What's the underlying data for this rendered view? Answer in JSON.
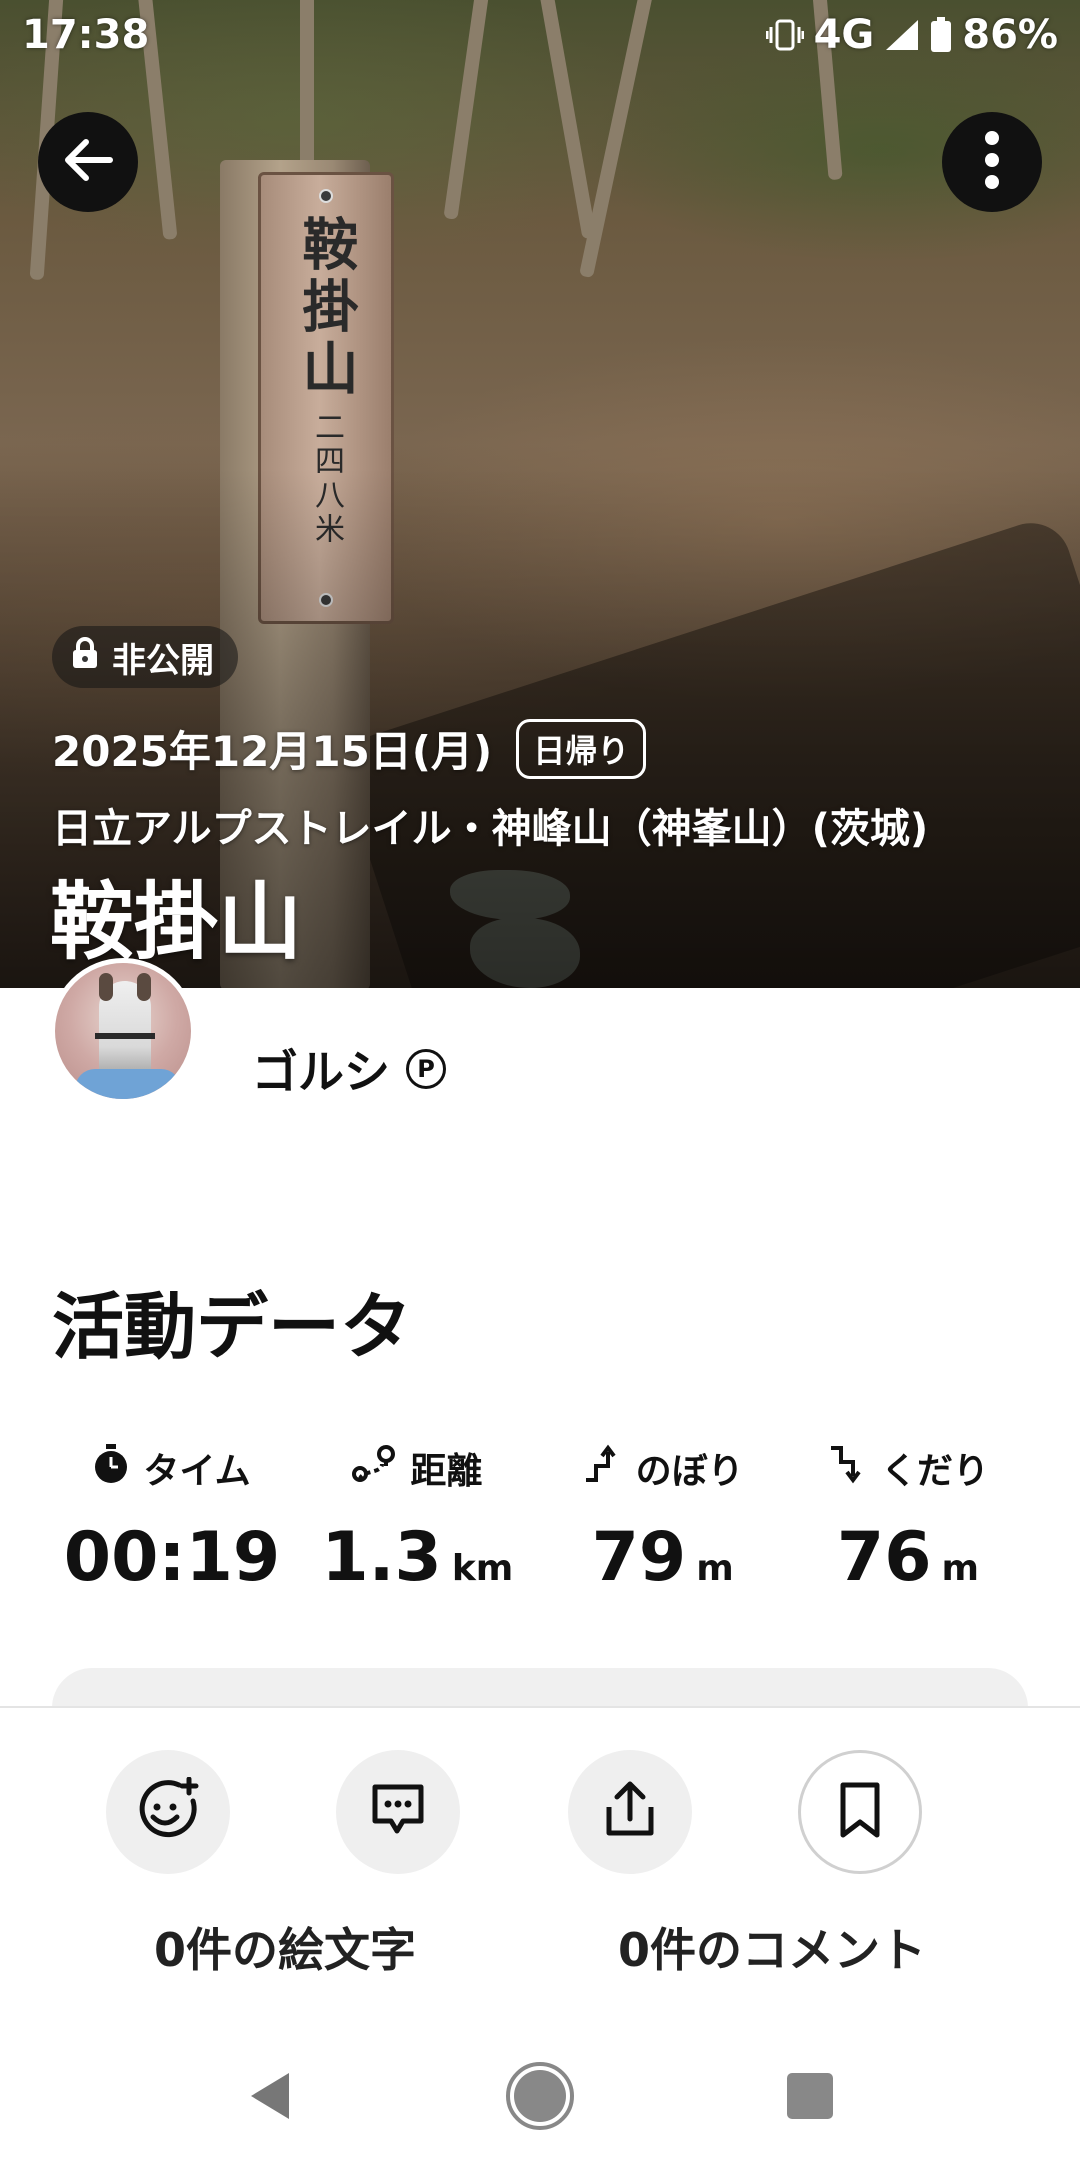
{
  "status_bar": {
    "time": "17:38",
    "network": "4G",
    "battery": "86%"
  },
  "hero": {
    "visibility": "非公開",
    "date": "2025年12月15日(月)",
    "trip_type": "日帰り",
    "area": "日立アルプストレイル・神峰山（神峯山）(茨城)",
    "title": "鞍掛山",
    "sign_name": "鞍掛山",
    "sign_height": "二四八米"
  },
  "user": {
    "name": "ゴルシ",
    "badge": "P"
  },
  "activity": {
    "heading": "活動データ",
    "stats": [
      {
        "icon": "timer-icon",
        "label": "タイム",
        "value": "00:19",
        "unit": ""
      },
      {
        "icon": "distance-icon",
        "label": "距離",
        "value": "1.3",
        "unit": "km"
      },
      {
        "icon": "ascent-icon",
        "label": "のぼり",
        "value": "79",
        "unit": "m"
      },
      {
        "icon": "descent-icon",
        "label": "くだり",
        "value": "76",
        "unit": "m"
      }
    ]
  },
  "actions": {
    "emoji_count": "0件の絵文字",
    "comment_count": "0件のコメント"
  },
  "colors": {
    "text": "#111111",
    "button_bg": "#efefef",
    "overlay_btn": "#111111"
  }
}
